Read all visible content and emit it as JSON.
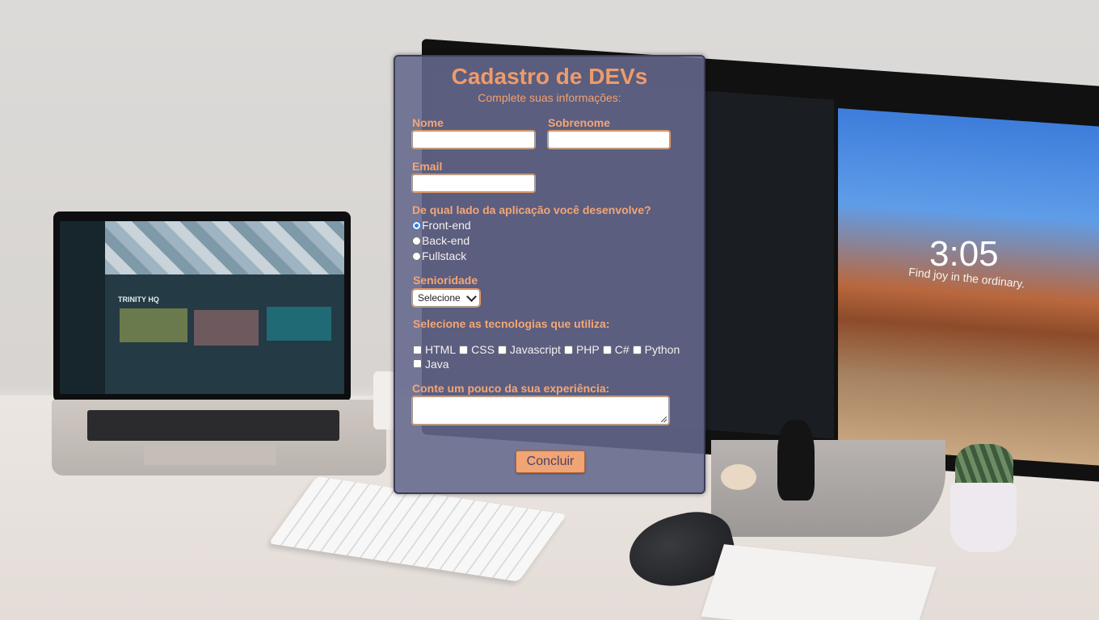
{
  "form": {
    "title": "Cadastro de DEVs",
    "subtitle": "Complete suas informações:",
    "first_name": {
      "label": "Nome",
      "value": ""
    },
    "last_name": {
      "label": "Sobrenome",
      "value": ""
    },
    "email": {
      "label": "Email",
      "value": ""
    },
    "side_question": "De qual lado da aplicação você desenvolve?",
    "side_options": [
      {
        "label": "Front-end",
        "checked": true
      },
      {
        "label": "Back-end",
        "checked": false
      },
      {
        "label": "Fullstack",
        "checked": false
      }
    ],
    "seniority": {
      "label": "Senioridade",
      "selected": "Selecione"
    },
    "tech_question": "Selecione as tecnologias que utiliza:",
    "technologies": [
      "HTML",
      "CSS",
      "Javascript",
      "PHP",
      "C#",
      "Python",
      "Java"
    ],
    "experience": {
      "label": "Conte um pouco da sua experiência:",
      "value": ""
    },
    "submit_label": "Concluir"
  },
  "background": {
    "lock_time": "3:05",
    "lock_subtitle": "Find joy in the ordinary.",
    "workspace_title": "TRINITY HQ"
  },
  "colors": {
    "accent": "#ef9b6a",
    "card": "#64688c",
    "radio_checked": "#3b79d8"
  }
}
